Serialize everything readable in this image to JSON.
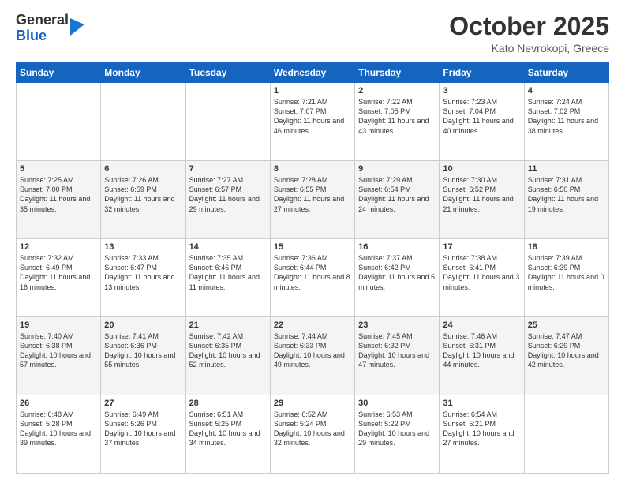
{
  "logo": {
    "general": "General",
    "blue": "Blue"
  },
  "title": "October 2025",
  "location": "Kato Nevrokopi, Greece",
  "days_header": [
    "Sunday",
    "Monday",
    "Tuesday",
    "Wednesday",
    "Thursday",
    "Friday",
    "Saturday"
  ],
  "weeks": [
    [
      {
        "day": "",
        "sunrise": "",
        "sunset": "",
        "daylight": ""
      },
      {
        "day": "",
        "sunrise": "",
        "sunset": "",
        "daylight": ""
      },
      {
        "day": "",
        "sunrise": "",
        "sunset": "",
        "daylight": ""
      },
      {
        "day": "1",
        "sunrise": "Sunrise: 7:21 AM",
        "sunset": "Sunset: 7:07 PM",
        "daylight": "Daylight: 11 hours and 46 minutes."
      },
      {
        "day": "2",
        "sunrise": "Sunrise: 7:22 AM",
        "sunset": "Sunset: 7:05 PM",
        "daylight": "Daylight: 11 hours and 43 minutes."
      },
      {
        "day": "3",
        "sunrise": "Sunrise: 7:23 AM",
        "sunset": "Sunset: 7:04 PM",
        "daylight": "Daylight: 11 hours and 40 minutes."
      },
      {
        "day": "4",
        "sunrise": "Sunrise: 7:24 AM",
        "sunset": "Sunset: 7:02 PM",
        "daylight": "Daylight: 11 hours and 38 minutes."
      }
    ],
    [
      {
        "day": "5",
        "sunrise": "Sunrise: 7:25 AM",
        "sunset": "Sunset: 7:00 PM",
        "daylight": "Daylight: 11 hours and 35 minutes."
      },
      {
        "day": "6",
        "sunrise": "Sunrise: 7:26 AM",
        "sunset": "Sunset: 6:59 PM",
        "daylight": "Daylight: 11 hours and 32 minutes."
      },
      {
        "day": "7",
        "sunrise": "Sunrise: 7:27 AM",
        "sunset": "Sunset: 6:57 PM",
        "daylight": "Daylight: 11 hours and 29 minutes."
      },
      {
        "day": "8",
        "sunrise": "Sunrise: 7:28 AM",
        "sunset": "Sunset: 6:55 PM",
        "daylight": "Daylight: 11 hours and 27 minutes."
      },
      {
        "day": "9",
        "sunrise": "Sunrise: 7:29 AM",
        "sunset": "Sunset: 6:54 PM",
        "daylight": "Daylight: 11 hours and 24 minutes."
      },
      {
        "day": "10",
        "sunrise": "Sunrise: 7:30 AM",
        "sunset": "Sunset: 6:52 PM",
        "daylight": "Daylight: 11 hours and 21 minutes."
      },
      {
        "day": "11",
        "sunrise": "Sunrise: 7:31 AM",
        "sunset": "Sunset: 6:50 PM",
        "daylight": "Daylight: 11 hours and 19 minutes."
      }
    ],
    [
      {
        "day": "12",
        "sunrise": "Sunrise: 7:32 AM",
        "sunset": "Sunset: 6:49 PM",
        "daylight": "Daylight: 11 hours and 16 minutes."
      },
      {
        "day": "13",
        "sunrise": "Sunrise: 7:33 AM",
        "sunset": "Sunset: 6:47 PM",
        "daylight": "Daylight: 11 hours and 13 minutes."
      },
      {
        "day": "14",
        "sunrise": "Sunrise: 7:35 AM",
        "sunset": "Sunset: 6:46 PM",
        "daylight": "Daylight: 11 hours and 11 minutes."
      },
      {
        "day": "15",
        "sunrise": "Sunrise: 7:36 AM",
        "sunset": "Sunset: 6:44 PM",
        "daylight": "Daylight: 11 hours and 8 minutes."
      },
      {
        "day": "16",
        "sunrise": "Sunrise: 7:37 AM",
        "sunset": "Sunset: 6:42 PM",
        "daylight": "Daylight: 11 hours and 5 minutes."
      },
      {
        "day": "17",
        "sunrise": "Sunrise: 7:38 AM",
        "sunset": "Sunset: 6:41 PM",
        "daylight": "Daylight: 11 hours and 3 minutes."
      },
      {
        "day": "18",
        "sunrise": "Sunrise: 7:39 AM",
        "sunset": "Sunset: 6:39 PM",
        "daylight": "Daylight: 11 hours and 0 minutes."
      }
    ],
    [
      {
        "day": "19",
        "sunrise": "Sunrise: 7:40 AM",
        "sunset": "Sunset: 6:38 PM",
        "daylight": "Daylight: 10 hours and 57 minutes."
      },
      {
        "day": "20",
        "sunrise": "Sunrise: 7:41 AM",
        "sunset": "Sunset: 6:36 PM",
        "daylight": "Daylight: 10 hours and 55 minutes."
      },
      {
        "day": "21",
        "sunrise": "Sunrise: 7:42 AM",
        "sunset": "Sunset: 6:35 PM",
        "daylight": "Daylight: 10 hours and 52 minutes."
      },
      {
        "day": "22",
        "sunrise": "Sunrise: 7:44 AM",
        "sunset": "Sunset: 6:33 PM",
        "daylight": "Daylight: 10 hours and 49 minutes."
      },
      {
        "day": "23",
        "sunrise": "Sunrise: 7:45 AM",
        "sunset": "Sunset: 6:32 PM",
        "daylight": "Daylight: 10 hours and 47 minutes."
      },
      {
        "day": "24",
        "sunrise": "Sunrise: 7:46 AM",
        "sunset": "Sunset: 6:31 PM",
        "daylight": "Daylight: 10 hours and 44 minutes."
      },
      {
        "day": "25",
        "sunrise": "Sunrise: 7:47 AM",
        "sunset": "Sunset: 6:29 PM",
        "daylight": "Daylight: 10 hours and 42 minutes."
      }
    ],
    [
      {
        "day": "26",
        "sunrise": "Sunrise: 6:48 AM",
        "sunset": "Sunset: 5:28 PM",
        "daylight": "Daylight: 10 hours and 39 minutes."
      },
      {
        "day": "27",
        "sunrise": "Sunrise: 6:49 AM",
        "sunset": "Sunset: 5:26 PM",
        "daylight": "Daylight: 10 hours and 37 minutes."
      },
      {
        "day": "28",
        "sunrise": "Sunrise: 6:51 AM",
        "sunset": "Sunset: 5:25 PM",
        "daylight": "Daylight: 10 hours and 34 minutes."
      },
      {
        "day": "29",
        "sunrise": "Sunrise: 6:52 AM",
        "sunset": "Sunset: 5:24 PM",
        "daylight": "Daylight: 10 hours and 32 minutes."
      },
      {
        "day": "30",
        "sunrise": "Sunrise: 6:53 AM",
        "sunset": "Sunset: 5:22 PM",
        "daylight": "Daylight: 10 hours and 29 minutes."
      },
      {
        "day": "31",
        "sunrise": "Sunrise: 6:54 AM",
        "sunset": "Sunset: 5:21 PM",
        "daylight": "Daylight: 10 hours and 27 minutes."
      },
      {
        "day": "",
        "sunrise": "",
        "sunset": "",
        "daylight": ""
      }
    ]
  ]
}
